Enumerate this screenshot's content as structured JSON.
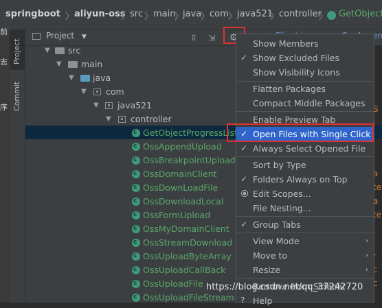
{
  "breadcrumb": {
    "items": [
      "springboot",
      "aliyun-oss",
      "src",
      "main",
      "java",
      "com",
      "java521",
      "controller",
      "GetObjectP"
    ]
  },
  "left_fragments": [
    "前",
    "志",
    "序"
  ],
  "tool_tabs": {
    "project": "Project",
    "commit": "Commit"
  },
  "panel": {
    "title": "Project",
    "tab_fragments": [
      "ssClient.java",
      "OssAppen"
    ]
  },
  "tree": {
    "src": "src",
    "main": "main",
    "java": "java",
    "com": "com",
    "java521": "java521",
    "controller": "controller",
    "classes": [
      "GetObjectProgressListe",
      "OssAppendUpload",
      "OssBreakpointUpload",
      "OssDomainClient",
      "OssDownLoadFile",
      "OssDownloadLocal",
      "OssFormUpload",
      "OssMyDomainClient",
      "OssStreamDownload",
      "OssUploadByteArray",
      "OssUploadCallBack",
      "OssUploadFile",
      "OssUploadFileStream"
    ]
  },
  "menu": {
    "items": [
      {
        "label": "Show Members",
        "checked": false
      },
      {
        "label": "Show Excluded Files",
        "checked": true
      },
      {
        "label": "Show Visibility Icons",
        "checked": false
      },
      {
        "label": "Flatten Packages",
        "checked": false
      },
      {
        "label": "Compact Middle Packages",
        "checked": false
      },
      {
        "label": "Enable Preview Tab",
        "checked": false
      },
      {
        "label": "Open Files with Single Click",
        "checked": true,
        "highlighted": true
      },
      {
        "label": "Always Select Opened File",
        "checked": true
      },
      {
        "label": "Sort by Type",
        "checked": false
      },
      {
        "label": "Folders Always on Top",
        "checked": true
      },
      {
        "label": "Edit Scopes...",
        "radio": true
      },
      {
        "label": "File Nesting...",
        "checked": false
      },
      {
        "label": "Group Tabs",
        "checked": true
      },
      {
        "label": "View Mode",
        "submenu": true
      },
      {
        "label": "Move to",
        "submenu": true
      },
      {
        "label": "Resize",
        "submenu": true
      },
      {
        "label": "Remove from Sidebar",
        "checked": false
      },
      {
        "label": "Help",
        "checked": false
      }
    ]
  },
  "editor_fragments": [
    "S",
    "l",
    "a",
    "te",
    "a",
    "te",
    "r",
    "c",
    "c"
  ],
  "watermark": "https://blog.csdn.net/qq_37242720",
  "colors": {
    "highlight": "#2f65ca",
    "annotation_box": "#e0302f",
    "class_icon": "#3e9a7a"
  }
}
